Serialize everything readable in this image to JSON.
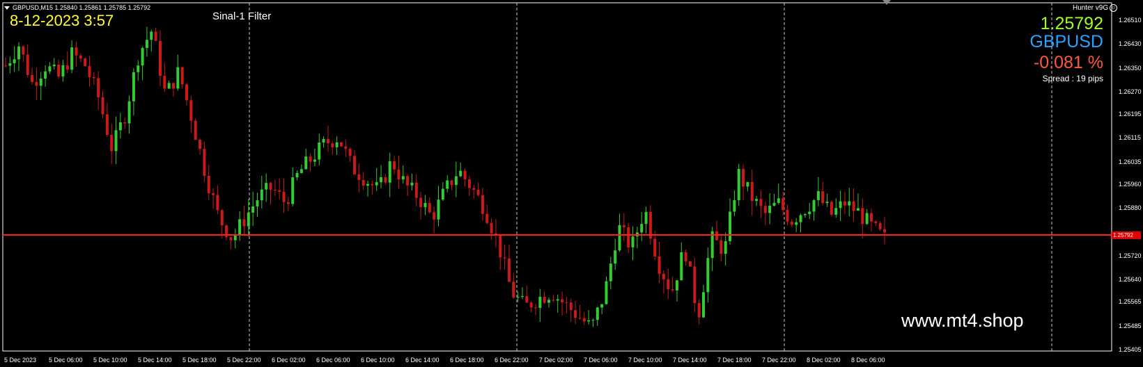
{
  "header": {
    "symbol_line": "GBPUSD,M15  1.25840 1.25861 1.25785 1.25792",
    "datetime": "8-12-2023 3:57",
    "indicator_label": "Sinal-1 Filter",
    "hunter_label": "Hunter v9G"
  },
  "info_panel": {
    "bid_price": "1.25792",
    "symbol": "GBPUSD",
    "change_pct": "-0.081 %",
    "spread": "Spread : 19 pips"
  },
  "watermark": "www.mt4.shop",
  "colors": {
    "bull_candle": "#33cc33",
    "bear_candle": "#cc1a1a",
    "price_line": "#ff2020",
    "bid_price": "#9cff2e",
    "symbol": "#29a3ff",
    "change": "#ff5a3c",
    "datetime": "#ffff33"
  },
  "price_axis": [
    {
      "label": "1.26510",
      "value": 1.2651
    },
    {
      "label": "1.26430",
      "value": 1.2643
    },
    {
      "label": "1.26350",
      "value": 1.2635
    },
    {
      "label": "1.26270",
      "value": 1.2627
    },
    {
      "label": "1.26195",
      "value": 1.26195
    },
    {
      "label": "1.26115",
      "value": 1.26115
    },
    {
      "label": "1.26035",
      "value": 1.26035
    },
    {
      "label": "1.25960",
      "value": 1.2596
    },
    {
      "label": "1.25880",
      "value": 1.2588
    },
    {
      "label": "1.25720",
      "value": 1.2572
    },
    {
      "label": "1.25640",
      "value": 1.2564
    },
    {
      "label": "1.25565",
      "value": 1.25565
    },
    {
      "label": "1.25485",
      "value": 1.25485
    },
    {
      "label": "1.25405",
      "value": 1.25405
    }
  ],
  "time_axis": [
    "5 Dec 2023",
    "5 Dec 06:00",
    "5 Dec 10:00",
    "5 Dec 14:00",
    "5 Dec 18:00",
    "5 Dec 22:00",
    "6 Dec 02:00",
    "6 Dec 06:00",
    "6 Dec 10:00",
    "6 Dec 14:00",
    "6 Dec 18:00",
    "6 Dec 22:00",
    "7 Dec 02:00",
    "7 Dec 06:00",
    "7 Dec 10:00",
    "7 Dec 14:00",
    "7 Dec 18:00",
    "7 Dec 22:00",
    "8 Dec 02:00",
    "8 Dec 06:00"
  ],
  "current_price": {
    "label": "1.25792",
    "value": 1.25792
  },
  "price_path": [
    1.2636,
    1.2643,
    1.263,
    1.2636,
    1.2632,
    1.264,
    1.2636,
    1.2625,
    1.2608,
    1.262,
    1.264,
    1.2648,
    1.2626,
    1.2634,
    1.2618,
    1.26,
    1.2585,
    1.2578,
    1.2585,
    1.2592,
    1.2595,
    1.259,
    1.26,
    1.2605,
    1.261,
    1.2612,
    1.2602,
    1.2598,
    1.2594,
    1.2604,
    1.2596,
    1.2592,
    1.2585,
    1.2594,
    1.2601,
    1.2595,
    1.2588,
    1.2576,
    1.256,
    1.2555,
    1.2558,
    1.256,
    1.2556,
    1.2552,
    1.2548,
    1.256,
    1.2582,
    1.2575,
    1.2588,
    1.257,
    1.256,
    1.2575,
    1.2552,
    1.2578,
    1.2574,
    1.26,
    1.2592,
    1.2586,
    1.259,
    1.2584,
    1.2588,
    1.2592,
    1.2586,
    1.259,
    1.2587,
    1.2582,
    1.2578
  ]
}
